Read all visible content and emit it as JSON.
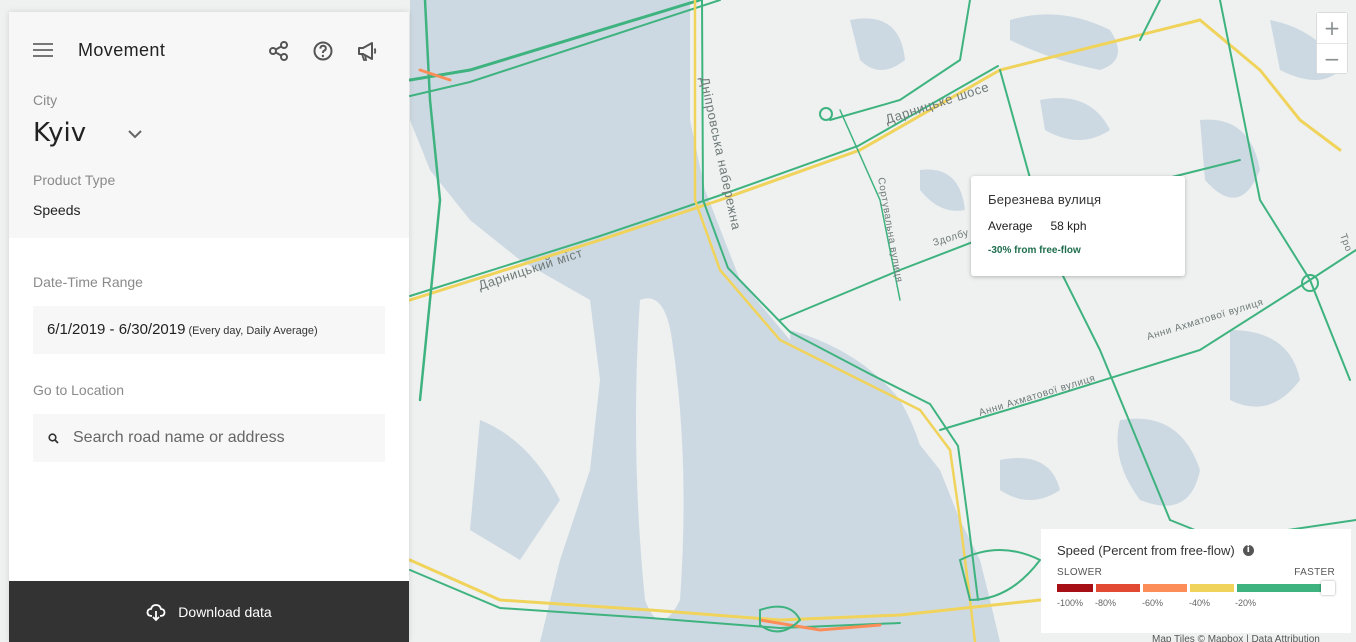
{
  "app": {
    "title": "Movement"
  },
  "header": {
    "icons": [
      "share-icon",
      "help-icon",
      "megaphone-icon"
    ]
  },
  "filters": {
    "city_label": "City",
    "city_value": "Kyiv",
    "product_label": "Product Type",
    "product_value": "Speeds",
    "datetime_label": "Date-Time Range",
    "datetime_value": "6/1/2019 - 6/30/2019",
    "datetime_sub": "(Every day, Daily Average)",
    "location_label": "Go to Location",
    "location_placeholder": "Search road name or address"
  },
  "download": {
    "label": "Download data"
  },
  "map": {
    "road_labels": [
      "Дарницьке шосе",
      "Дніпровська набережна",
      "Дарницький міст",
      "Сортувальна вулиця",
      "Анни Ахматової вулиця",
      "Анни Ахматової вулиця",
      "Здолбу",
      "Тро"
    ],
    "zoom_in": "+",
    "zoom_out": "−"
  },
  "tooltip": {
    "road": "Березнева вулиця",
    "avg_label": "Average",
    "avg_value": "58 kph",
    "diff": "-30% from free-flow"
  },
  "legend": {
    "title": "Speed (Percent from free-flow)",
    "slower": "SLOWER",
    "faster": "FASTER",
    "ticks": [
      "-100%",
      "-80%",
      "-60%",
      "-40%",
      "-20%"
    ],
    "colors": [
      "#a50f15",
      "#e34a33",
      "#fc8d59",
      "#f0d35a",
      "#3fb37f"
    ]
  },
  "attribution": "Map Tiles © Mapbox | Data Attribution"
}
